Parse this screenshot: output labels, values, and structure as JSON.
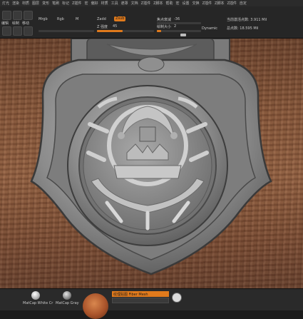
{
  "menubar": {
    "items": [
      "灯光",
      "渲染",
      "材质",
      "图层",
      "变形",
      "笔刷",
      "标记",
      "Z插件",
      "宏",
      "偏好",
      "材质",
      "工具",
      "遮罩",
      "文档",
      "Z插件",
      "Z脚本",
      "帮助",
      "宏",
      "设置",
      "交换",
      "Z插件",
      "Z脚本",
      "Z插件",
      "自定"
    ]
  },
  "toolbar": {
    "mode_labels": [
      "绘制",
      "移动",
      "缩放",
      "旋转"
    ],
    "mode_label_editable": "编辑",
    "mrgb": "Mrgb",
    "rgb": "Rgb",
    "m": "M",
    "zadd": "Zadd",
    "zsub": "Zsub",
    "z_intensity_label": "Z 强度",
    "z_intensity_value": "45",
    "focal_shift_label": "焦点衰减",
    "focal_shift_value": "-36",
    "draw_size_label": "绘制大小",
    "draw_size_value": "2",
    "dynamic": "Dynamic",
    "active_points": "当前激活点数: 3.911 Mil",
    "total_points": "总点数: 18.595 Mil",
    "z_intensity_fraction": 0.45,
    "draw_size_fraction": 0.1
  },
  "bottombar": {
    "materials": [
      "MatCap White Cr",
      "MatCap Gray"
    ],
    "texture_label": "纹理贴图 Fiber Mesh"
  },
  "colors": {
    "accent": "#e07a1c",
    "clay": "#8f8f8f",
    "leather": "#8a5a3d"
  }
}
